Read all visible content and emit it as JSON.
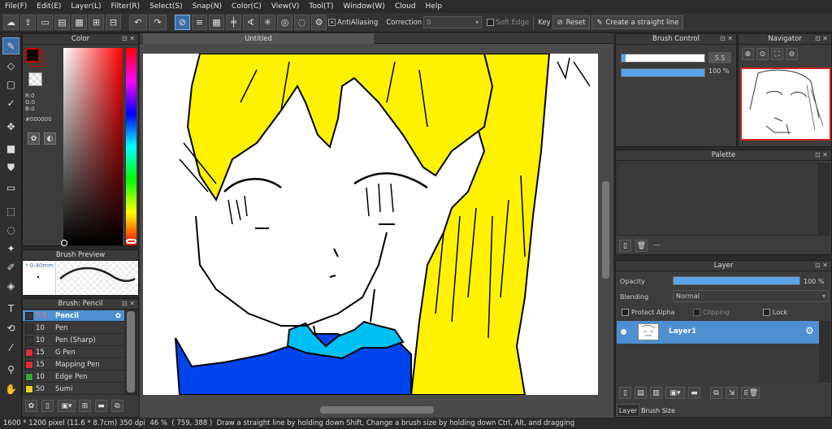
{
  "menu": [
    "File(F)",
    "Edit(E)",
    "Layer(L)",
    "Filter(R)",
    "Select(S)",
    "Snap(N)",
    "Color(C)",
    "View(V)",
    "Tool(T)",
    "Window(W)",
    "Cloud",
    "Help"
  ],
  "toolbar": {
    "antialiasing_label": "AntiAliasing",
    "correction_label": "Correction",
    "correction_value": "0",
    "soft_edge_label": "Soft Edge",
    "key_label": "Key",
    "reset_label": "Reset",
    "straight_line_label": "Create a straight line"
  },
  "color_panel": {
    "title": "Color",
    "r": "R:0",
    "g": "G:0",
    "b": "B:0",
    "hex": "#000000",
    "fg_color": "#000000",
    "bg_color": "#cc0000"
  },
  "brush_preview": {
    "title": "Brush Preview",
    "size": "* 0.40mm"
  },
  "brush_list": {
    "title": "Brush: Pencil",
    "items": [
      {
        "size": "5.5",
        "name": "Pencil",
        "color": "#333333",
        "selected": true
      },
      {
        "size": "10",
        "name": "Pen",
        "color": "#333333"
      },
      {
        "size": "10",
        "name": "Pen (Sharp)",
        "color": "#333333"
      },
      {
        "size": "15",
        "name": "G Pen",
        "color": "#e03030"
      },
      {
        "size": "15",
        "name": "Mapping Pen",
        "color": "#e03030"
      },
      {
        "size": "10",
        "name": "Edge Pen",
        "color": "#30b030"
      },
      {
        "size": "50",
        "name": "Sumi",
        "color": "#f0d020"
      }
    ]
  },
  "canvas": {
    "tab_title": "Untitled"
  },
  "brush_control": {
    "title": "Brush Control",
    "size_value": "5.5",
    "opacity_value": "100 %",
    "size_fraction": 0.05,
    "opacity_fraction": 1.0
  },
  "navigator": {
    "title": "Navigator"
  },
  "palette": {
    "title": "Palette",
    "footer_text": "---"
  },
  "layer_panel": {
    "title": "Layer",
    "opacity_label": "Opacity",
    "opacity_value": "100 %",
    "opacity_fraction": 1.0,
    "blending_label": "Blending",
    "blending_value": "Normal",
    "protect_alpha_label": "Protect Alpha",
    "clipping_label": "Clipping",
    "lock_label": "Lock",
    "layers": [
      {
        "name": "Layer1"
      }
    ],
    "tab_layer": "Layer",
    "tab_brush_size": "Brush Size"
  },
  "status": {
    "dimensions": "1600 * 1200 pixel",
    "physical": "(11.6 * 8.7cm)",
    "dpi": "350 dpi",
    "zoom": "46 %",
    "coords": "( 759, 388 )",
    "hint": "Draw a straight line by holding down Shift, Change a brush size by holding down Ctrl, Alt, and dragging"
  },
  "colors": {
    "hair": "#fff200",
    "shirt": "#0044ee",
    "collar": "#00bff3",
    "accent": "#3a6ea5"
  }
}
